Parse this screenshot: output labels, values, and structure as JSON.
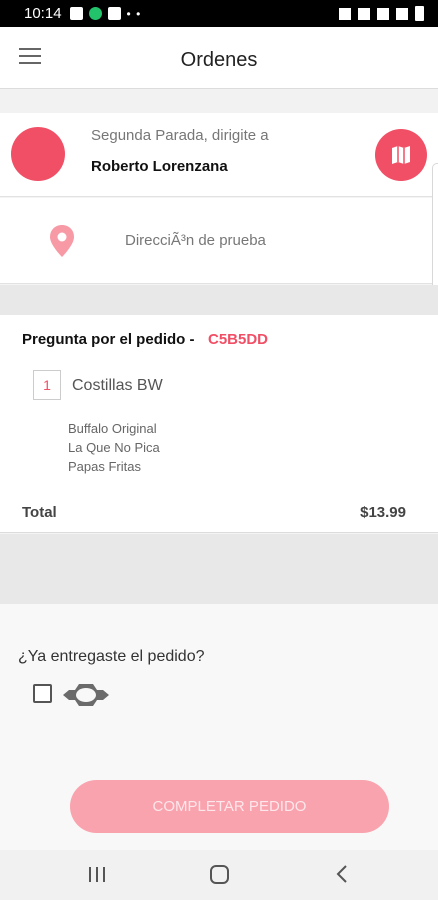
{
  "status_bar": {
    "time": "10:14"
  },
  "app_bar": {
    "title": "Ordenes"
  },
  "stop": {
    "subtitle": "Segunda Parada, dirigite a",
    "name": "Roberto Lorenzana"
  },
  "address": {
    "text": "DirecciÃ³n de prueba"
  },
  "order": {
    "label": "Pregunta por el pedido -",
    "code": "C5B5DD",
    "items": [
      {
        "qty": "1",
        "name": "Costillas BW",
        "modifiers": [
          "Buffalo Original",
          "La Que No Pica",
          "Papas Fritas"
        ]
      }
    ],
    "total_label": "Total",
    "total_value": "$13.99"
  },
  "confirm": {
    "question": "¿Ya entregaste el pedido?",
    "button_label": "COMPLETAR PEDIDO"
  },
  "colors": {
    "accent": "#f14f66",
    "button_disabled": "#f9a3ae"
  },
  "icons": {
    "menu": "hamburger-icon",
    "map": "map-icon",
    "pin": "location-pin-icon",
    "delivered": "hexagon-bolt-icon"
  }
}
